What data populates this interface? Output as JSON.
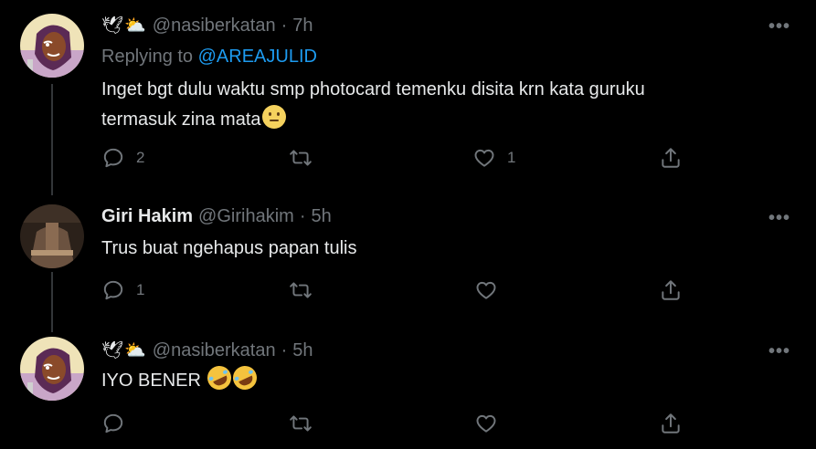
{
  "tweets": [
    {
      "user_emoji": "🕊⛅",
      "display_name": "",
      "handle": "@nasiberkatan",
      "dot": "·",
      "time": "7h",
      "replying_prefix": "Replying to",
      "replying_handle": "@AREAJULID",
      "text_line1": "Inget bgt dulu waktu smp photocard temenku disita krn kata guruku",
      "text_line2": "termasuk zina mata",
      "text_emoji": "slightly-smiling-face",
      "reply_count": "2",
      "retweet_count": "",
      "like_count": "1"
    },
    {
      "display_name": "Giri Hakim",
      "handle": "@Girihakim",
      "dot": "·",
      "time": "5h",
      "text_line1": "Trus buat ngehapus papan tulis",
      "reply_count": "1",
      "retweet_count": "",
      "like_count": ""
    },
    {
      "user_emoji": "🕊⛅",
      "display_name": "",
      "handle": "@nasiberkatan",
      "dot": "·",
      "time": "5h",
      "text_line1": "IYO BENER",
      "text_emoji": "rofl-rofl",
      "reply_count": "",
      "retweet_count": "",
      "like_count": ""
    }
  ],
  "more_label": "•••",
  "colors": {
    "background": "#000000",
    "text": "#e7e9ea",
    "muted": "#71767b",
    "link": "#1d9bf0",
    "thread_line": "#333639"
  }
}
